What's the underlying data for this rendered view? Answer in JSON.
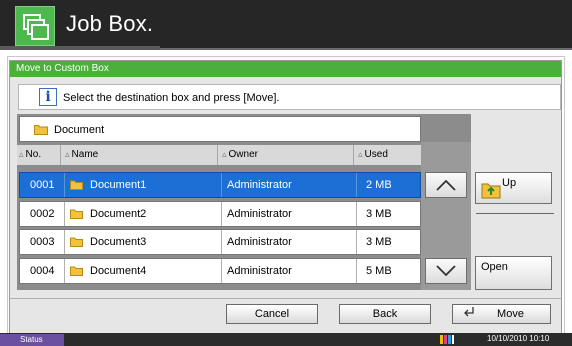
{
  "header": {
    "title": "Job Box.",
    "icon": "job-box-icon"
  },
  "dialog": {
    "title": "Move to Custom Box",
    "message": "Select the destination box and press [Move].",
    "current_path": "Document"
  },
  "table": {
    "columns": [
      "No.",
      "Name",
      "Owner",
      "Used"
    ],
    "rows": [
      {
        "no": "0001",
        "name": "Document1",
        "owner": "Administrator",
        "used": "2  MB",
        "selected": true
      },
      {
        "no": "0002",
        "name": "Document2",
        "owner": "Administrator",
        "used": "3  MB",
        "selected": false
      },
      {
        "no": "0003",
        "name": "Document3",
        "owner": "Administrator",
        "used": "3  MB",
        "selected": false
      },
      {
        "no": "0004",
        "name": "Document4",
        "owner": "Administrator",
        "used": "5  MB",
        "selected": false
      }
    ]
  },
  "side": {
    "up_label": "Up",
    "open_label": "Open"
  },
  "buttons": {
    "cancel": "Cancel",
    "back": "Back",
    "move": "Move"
  },
  "status": {
    "label": "Status",
    "datetime": "10/10/2010  10:10"
  },
  "colors": {
    "accent": "#4caf3b",
    "selection": "#1c6fd4",
    "status": "#6b4fa0"
  }
}
